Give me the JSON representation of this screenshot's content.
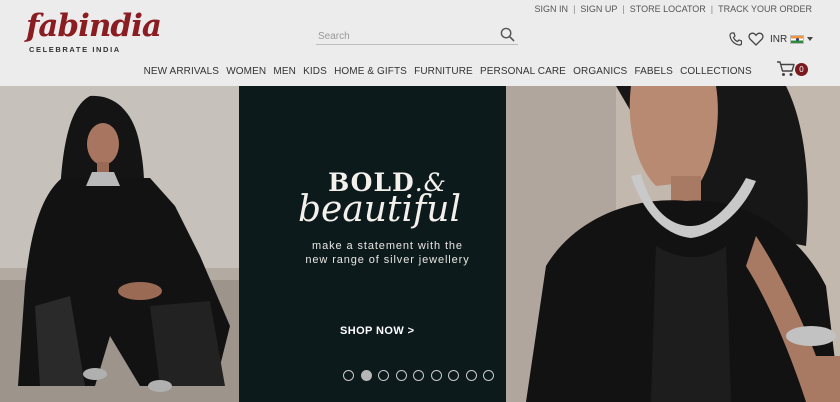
{
  "brand": {
    "name": "fabindia",
    "tagline": "CELEBRATE INDIA",
    "color": "#8b1d22"
  },
  "top_links": [
    "SIGN IN",
    "SIGN UP",
    "STORE LOCATOR",
    "TRACK YOUR ORDER"
  ],
  "search": {
    "placeholder": "Search",
    "icon": "search-icon"
  },
  "utility": {
    "phone_icon": "phone-icon",
    "wishlist_icon": "heart-icon",
    "currency": "INR",
    "flag": "india-flag-icon"
  },
  "nav": [
    "NEW ARRIVALS",
    "WOMEN",
    "MEN",
    "KIDS",
    "HOME & GIFTS",
    "FURNITURE",
    "PERSONAL CARE",
    "ORGANICS",
    "FABELS",
    "COLLECTIONS"
  ],
  "cart": {
    "icon": "cart-icon",
    "count": "0",
    "badge_color": "#7a1a1f"
  },
  "hero": {
    "headline_line1": "BOLD",
    "headline_amp": ".&",
    "headline_line2": "beautiful",
    "subtext_line1": "make a statement with the",
    "subtext_line2": "new range of silver jewellery",
    "cta": "SHOP NOW >",
    "panel_color": "#0d1a1c",
    "slides_total": 9,
    "active_slide": 2
  }
}
